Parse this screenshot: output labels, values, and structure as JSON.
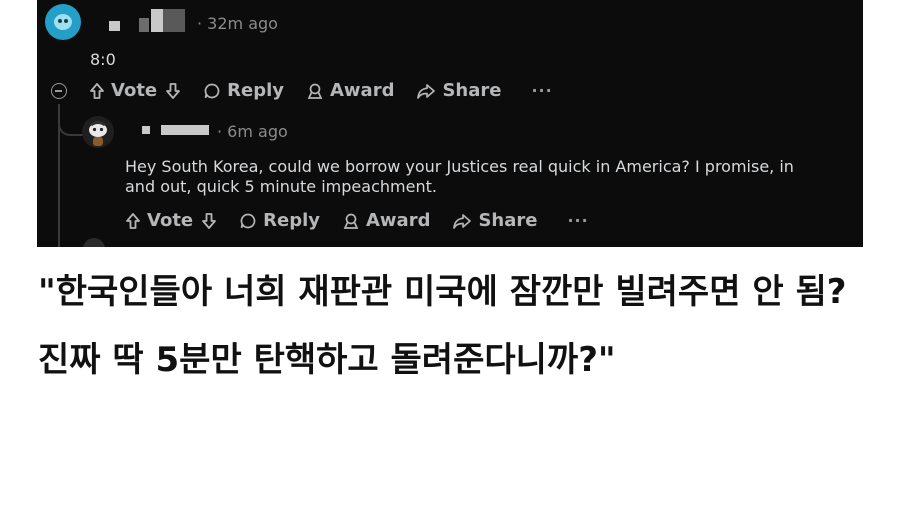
{
  "comment": {
    "timestamp": "· 32m ago",
    "body": "8:0",
    "actions": {
      "vote": "Vote",
      "reply": "Reply",
      "award": "Award",
      "share": "Share",
      "more": "···"
    }
  },
  "reply": {
    "timestamp": "· 6m ago",
    "body": "Hey South Korea, could we borrow your Justices real quick in America? I promise, in and out, quick 5 minute impeachment.",
    "actions": {
      "vote": "Vote",
      "reply": "Reply",
      "award": "Award",
      "share": "Share",
      "more": "···"
    }
  },
  "caption": "\"한국인들아 너희 재판관 미국에 잠깐만 빌려주면 안 됨? 진짜 딱 5분만 탄핵하고 돌려준다니까?\"",
  "colors": {
    "background": "#0c0c0d",
    "avatar_accent": "#24a0c8",
    "text": "#d7dadc",
    "muted": "#8b8b8b"
  }
}
